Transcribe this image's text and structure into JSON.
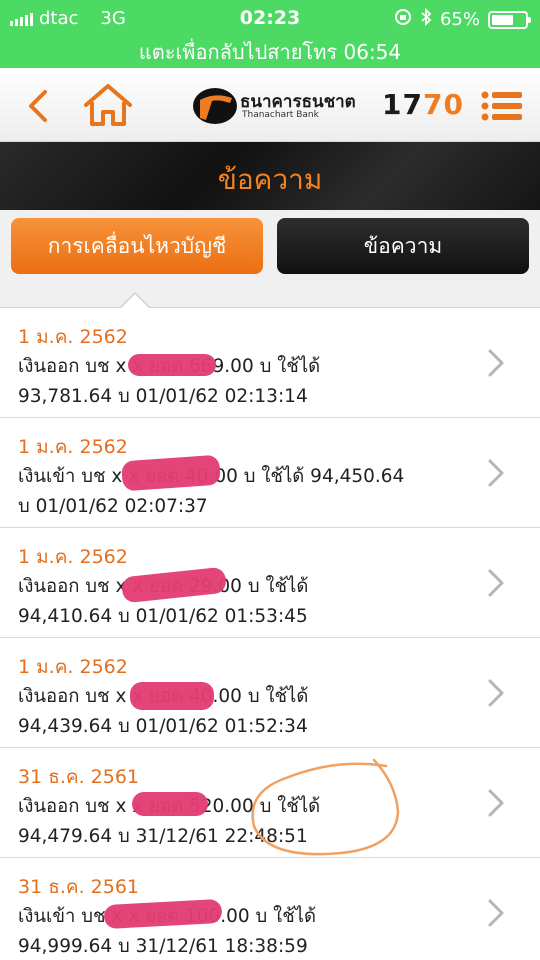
{
  "status_bar": {
    "carrier": "dtac",
    "network": "3G",
    "time": "02:23",
    "battery": "65%",
    "battery_level": 0.65
  },
  "call_banner": "แตะเพื่อกลับไปสายโทร 06:54",
  "header": {
    "bank_name": "ธนาคารธนชาต",
    "bank_name_en": "Thanachart Bank",
    "hotline_part1": "17",
    "hotline_part2": "70"
  },
  "page_title": "ข้อความ",
  "tabs": [
    {
      "label": "การเคลื่อนไหวบัญชี",
      "active": true
    },
    {
      "label": "ข้อความ",
      "active": false
    }
  ],
  "colors": {
    "accent_orange": "#f58220",
    "status_green": "#4cd964",
    "redaction_pink": "#e23d74",
    "annotation_orange": "#f0a060"
  },
  "transactions": [
    {
      "date": "1 ม.ค. 2562",
      "line1": "เงินออก บช x        x ยอด 669.00 บ ใช้ได้",
      "line2": "93,781.64 บ 01/01/62 02:13:14"
    },
    {
      "date": "1 ม.ค. 2562",
      "line1": "เงินเข้า บช x        x ยอด 40.00 บ ใช้ได้ 94,450.64",
      "line2": "บ 01/01/62 02:07:37"
    },
    {
      "date": "1 ม.ค. 2562",
      "line1": "เงินออก บช x        x ยอด 29.00 บ ใช้ได้",
      "line2": "94,410.64 บ 01/01/62 01:53:45"
    },
    {
      "date": "1 ม.ค. 2562",
      "line1": "เงินออก บช x        x ยอด 40.00 บ ใช้ได้",
      "line2": "94,439.64 บ 01/01/62 01:52:34"
    },
    {
      "date": "31 ธ.ค. 2561",
      "line1": "เงินออก บช x        x ยอด 520.00 บ ใช้ได้",
      "line2": "94,479.64 บ 31/12/61 22:48:51"
    },
    {
      "date": "31 ธ.ค. 2561",
      "line1": "เงินเข้า บช x        x ยอด 100.00 บ ใช้ได้",
      "line2": "94,999.64 บ 31/12/61 18:38:59"
    }
  ]
}
